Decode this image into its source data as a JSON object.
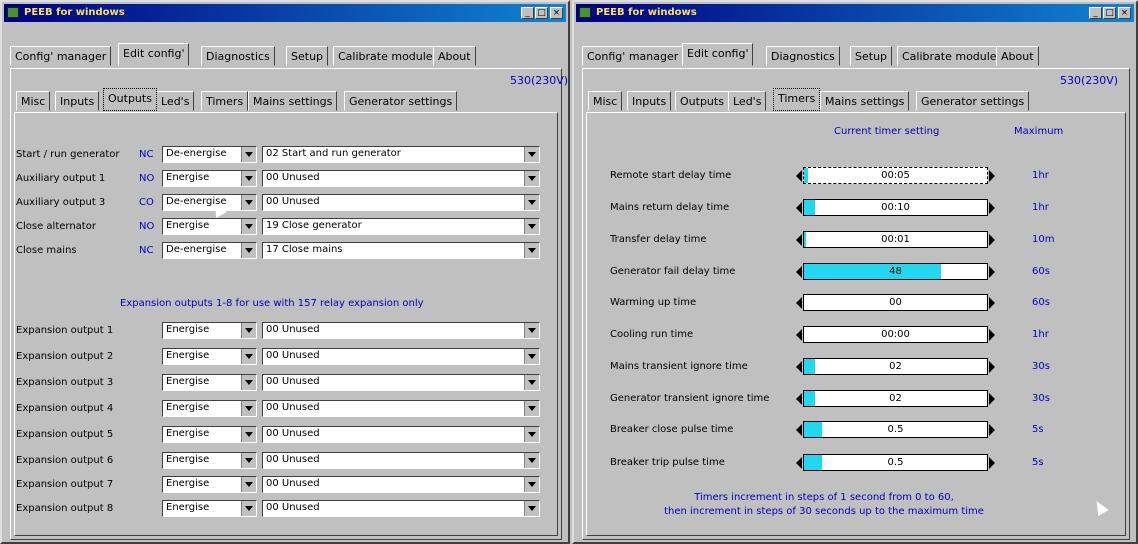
{
  "left": {
    "title": "PEEB for windows",
    "main_tabs": [
      "Config' manager",
      "Edit config'",
      "Diagnostics",
      "Setup",
      "Calibrate module",
      "About"
    ],
    "model": "530(230V)",
    "sub_tabs": [
      "Misc",
      "Inputs",
      "Outputs",
      "Led's",
      "Timers",
      "Mains settings",
      "Generator settings"
    ],
    "outputs": [
      {
        "label": "Start / run generator",
        "nc": "NC",
        "state": "De-energise",
        "function": "02 Start and run generator"
      },
      {
        "label": "Auxiliary output 1",
        "nc": "NO",
        "state": "Energise",
        "function": "00 Unused"
      },
      {
        "label": "Auxiliary output 3",
        "nc": "CO",
        "state": "De-energise",
        "function": "00 Unused"
      },
      {
        "label": "Close alternator",
        "nc": "NO",
        "state": "Energise",
        "function": "19 Close generator"
      },
      {
        "label": "Close mains",
        "nc": "NC",
        "state": "De-energise",
        "function": "17 Close mains"
      }
    ],
    "expansion_note": "Expansion outputs 1-8 for use with 157 relay expansion only",
    "expansion": [
      {
        "label": "Expansion output 1",
        "state": "Energise",
        "function": "00 Unused"
      },
      {
        "label": "Expansion output 2",
        "state": "Energise",
        "function": "00 Unused"
      },
      {
        "label": "Expansion output 3",
        "state": "Energise",
        "function": "00 Unused"
      },
      {
        "label": "Expansion output 4",
        "state": "Energise",
        "function": "00 Unused"
      },
      {
        "label": "Expansion output 5",
        "state": "Energise",
        "function": "00 Unused"
      },
      {
        "label": "Expansion output 6",
        "state": "Energise",
        "function": "00 Unused"
      },
      {
        "label": "Expansion output 7",
        "state": "Energise",
        "function": "00 Unused"
      },
      {
        "label": "Expansion output 8",
        "state": "Energise",
        "function": "00 Unused"
      }
    ]
  },
  "right": {
    "title": "PEEB for windows",
    "main_tabs": [
      "Config' manager",
      "Edit config'",
      "Diagnostics",
      "Setup",
      "Calibrate module",
      "About"
    ],
    "model": "530(230V)",
    "sub_tabs": [
      "Misc",
      "Inputs",
      "Outputs",
      "Led's",
      "Timers",
      "Mains settings",
      "Generator settings"
    ],
    "header_current": "Current timer setting",
    "header_max": "Maximum",
    "timers": [
      {
        "label": "Remote start delay time",
        "value": "00:05",
        "fill": 0.02,
        "max": "1hr"
      },
      {
        "label": "Mains return delay time",
        "value": "00:10",
        "fill": 0.06,
        "max": "1hr"
      },
      {
        "label": "Transfer delay time",
        "value": "00:01",
        "fill": 0.01,
        "max": "10m"
      },
      {
        "label": "Generator fail delay time",
        "value": "48",
        "fill": 0.75,
        "max": "60s"
      },
      {
        "label": "Warming up time",
        "value": "00",
        "fill": 0,
        "max": "60s"
      },
      {
        "label": "Cooling run time",
        "value": "00:00",
        "fill": 0,
        "max": "1hr"
      },
      {
        "label": "Mains transient ignore time",
        "value": "02",
        "fill": 0.06,
        "max": "30s"
      },
      {
        "label": "Generator transient ignore time",
        "value": "02",
        "fill": 0.06,
        "max": "30s"
      },
      {
        "label": "Breaker close pulse time",
        "value": "0.5",
        "fill": 0.1,
        "max": "5s"
      },
      {
        "label": "Breaker trip pulse time",
        "value": "0.5",
        "fill": 0.1,
        "max": "5s"
      }
    ],
    "footer1": "Timers increment in steps of 1 second from 0 to 60,",
    "footer2": "then increment in steps of 30 seconds up to the maximum time"
  },
  "colors": {
    "title_bar": "#000080",
    "accent_blue": "#0000c0",
    "slider_fill": "#22d8f0"
  }
}
